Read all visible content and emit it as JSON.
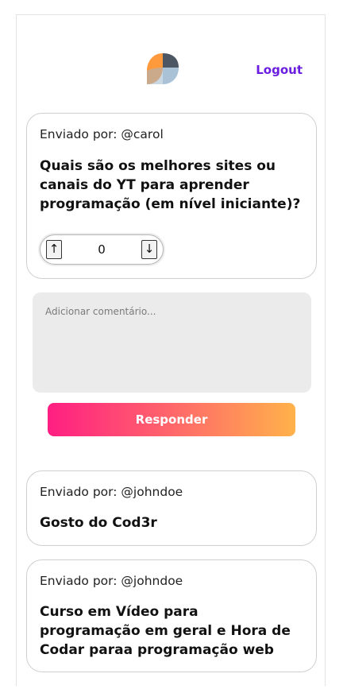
{
  "header": {
    "logout_label": "Logout",
    "logo_icon": "two-leaf-logo-icon",
    "logo_colors": [
      "#ff9a3c",
      "#4a5a6a",
      "#a9c2d6"
    ]
  },
  "question": {
    "author": "Enviado por: @carol",
    "title": "Quais são os melhores sites ou canais do YT para aprender programação (em nível iniciante)?",
    "votes": "0",
    "upvote_icon": "↑",
    "downvote_icon": "↓"
  },
  "comment": {
    "placeholder": "Adicionar comentário..."
  },
  "reply": {
    "label": "Responder",
    "gradient": [
      "#ff1e82",
      "#ffb24a"
    ]
  },
  "answers": [
    {
      "author": "Enviado por: @johndoe",
      "text": "Gosto do Cod3r"
    },
    {
      "author": "Enviado por: @johndoe",
      "text": "Curso em Vídeo para programação em geral e Hora de Codar paraa programação web"
    }
  ],
  "colors": {
    "accent": "#6a1de0",
    "input_bg": "#ebebeb",
    "card_border": "#cfcfcf"
  }
}
